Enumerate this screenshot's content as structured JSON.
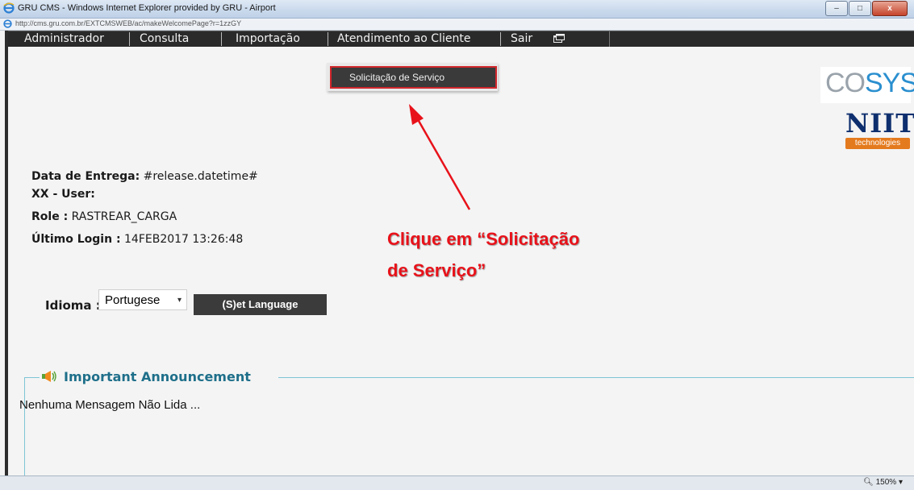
{
  "window": {
    "title": "GRU CMS - Windows Internet Explorer provided by GRU - Airport",
    "url": "http://cms.gru.com.br/EXTCMSWEB/ac/makeWelcomePage?r=1zzGY",
    "minimize_label": "–",
    "maximize_label": "□",
    "close_label": "x"
  },
  "nav": {
    "items": [
      {
        "label": "Administrador"
      },
      {
        "label": "Consulta"
      },
      {
        "label": "Importação"
      },
      {
        "label": "Atendimento ao Cliente"
      },
      {
        "label": "Sair"
      }
    ]
  },
  "dropdown": {
    "item_label": "Solicitação de Serviço"
  },
  "logos": {
    "cosys_co": "CO",
    "cosys_sys": "SYS",
    "niit": "NIIT",
    "niit_tagline": "technologies"
  },
  "info": {
    "delivery_label": "Data de Entrega:",
    "delivery_value": "#release.datetime#",
    "user_label": "XX - User:",
    "role_label": "Role :",
    "role_value": "RASTREAR_CARGA",
    "last_login_label": "Último Login :",
    "last_login_value": "14FEB2017 13:26:48"
  },
  "annotation": {
    "line1": "Clique em “Solicitação",
    "line2": "de Serviço”",
    "color": "#e8121a"
  },
  "language": {
    "label": "Idioma :",
    "selected": "Portugese",
    "button_label": "(S)et Language"
  },
  "announcement": {
    "title": "Important Announcement",
    "message": "Nenhuma Mensagem Não Lida ..."
  },
  "statusbar": {
    "zoom": "150%"
  }
}
